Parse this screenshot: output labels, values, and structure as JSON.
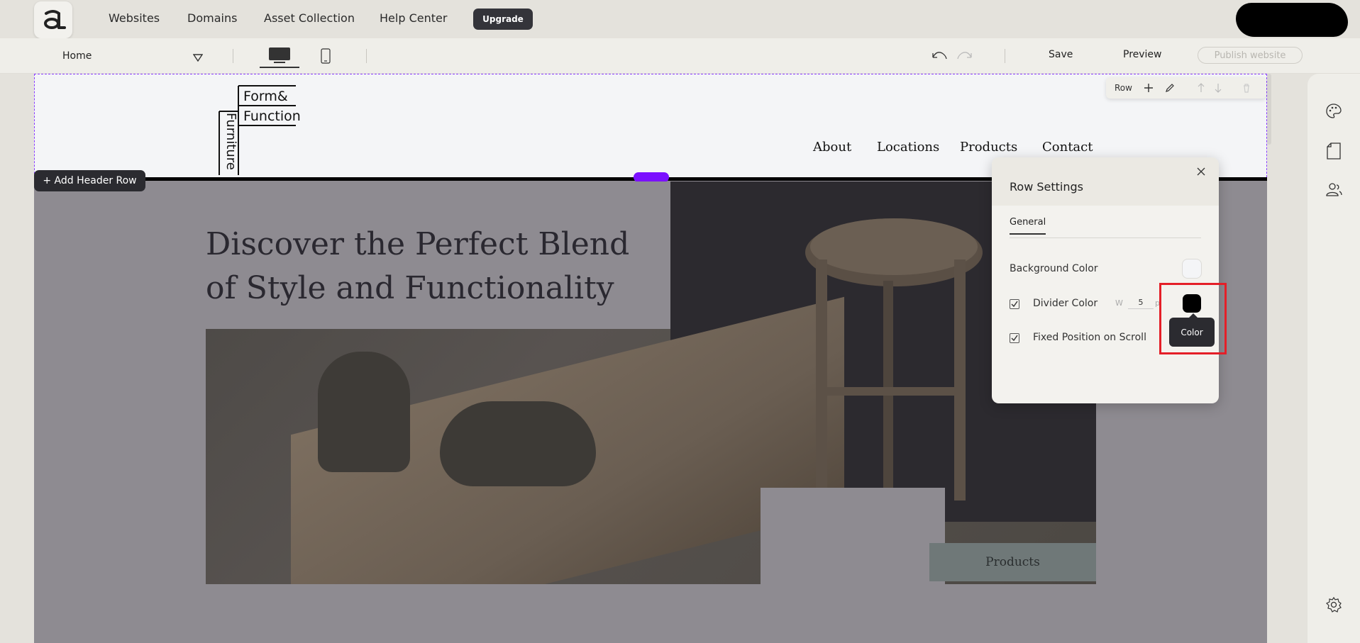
{
  "topnav": {
    "links": [
      "Websites",
      "Domains",
      "Asset Collection",
      "Help Center"
    ],
    "upgrade_label": "Upgrade"
  },
  "toolbar": {
    "page_selected": "Home",
    "save_label": "Save",
    "preview_label": "Preview",
    "publish_label": "Publish website"
  },
  "canvas": {
    "brand": {
      "form": "Form&",
      "function": "Function",
      "furniture": "Furniture"
    },
    "site_nav": [
      "About",
      "Locations",
      "Products",
      "Contact"
    ],
    "row_toolbar_label": "Row",
    "add_header_label": "+ Add Header Row",
    "hero_title": "Discover the Perfect Blend of Style and Functionality",
    "products_button": "Products"
  },
  "panel": {
    "title": "Row Settings",
    "tab": "General",
    "background_color_label": "Background Color",
    "divider_color_label": "Divider Color",
    "divider_width_prefix": "W",
    "divider_width": "5",
    "divider_width_unit": "p",
    "fixed_position_label": "Fixed Position on Scroll",
    "tooltip": "Color"
  },
  "colors": {
    "accent": "#7b10ff",
    "highlight": "#e41f28",
    "divider": "#000000",
    "background_swatch": "#f4f5f7"
  },
  "icons": {
    "palette": "palette-icon",
    "page": "page-icon",
    "users": "users-icon",
    "settings": "gear-icon"
  }
}
